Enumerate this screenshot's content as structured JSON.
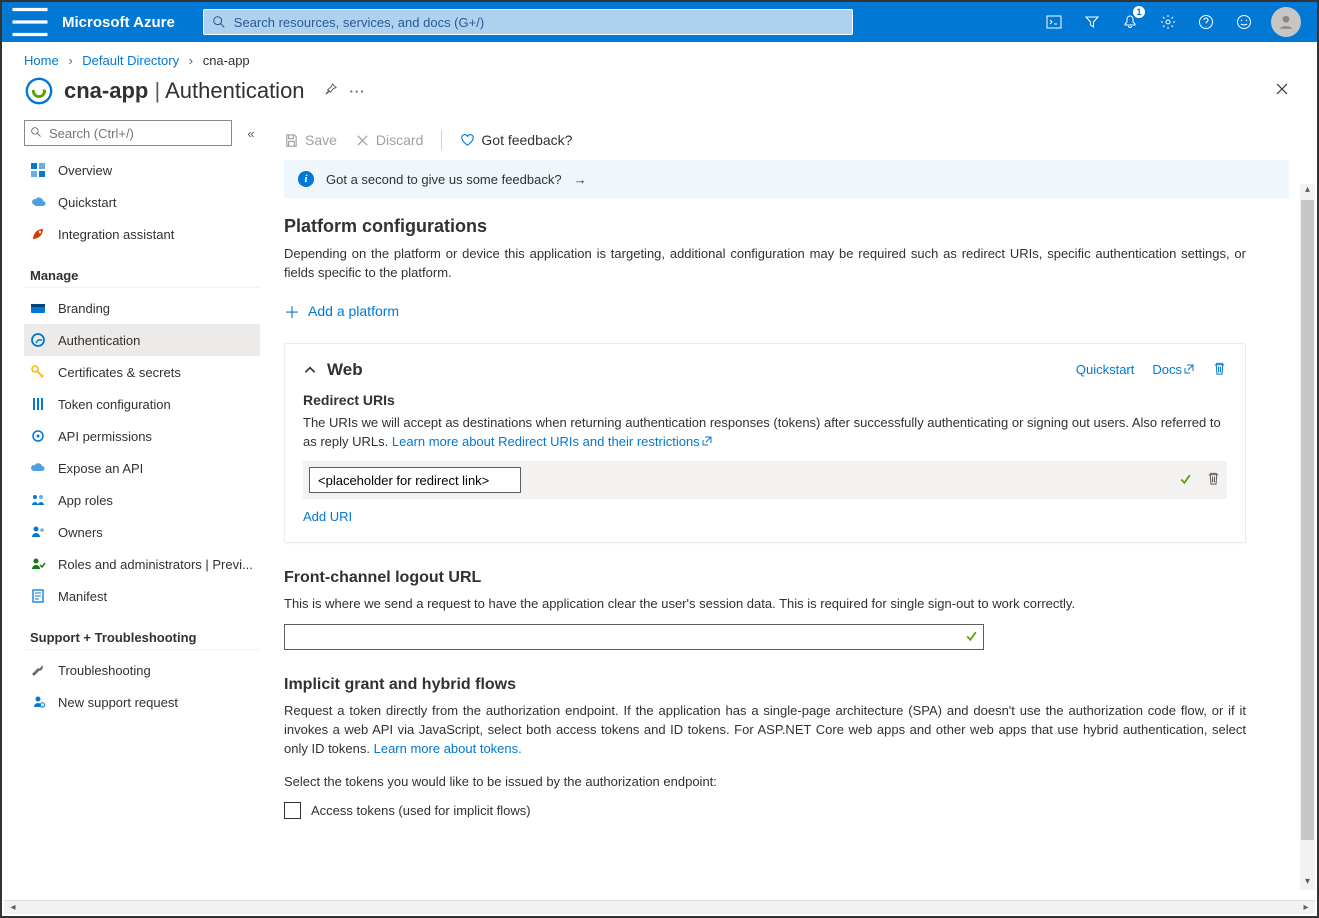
{
  "header": {
    "brand": "Microsoft Azure",
    "search_placeholder": "Search resources, services, and docs (G+/)",
    "notification_count": "1"
  },
  "breadcrumbs": {
    "items": [
      "Home",
      "Default Directory",
      "cna-app"
    ]
  },
  "title": {
    "app_name": "cna-app",
    "page_name": "Authentication"
  },
  "sidebar": {
    "search_placeholder": "Search (Ctrl+/)",
    "top_items": [
      {
        "label": "Overview",
        "icon": "overview-icon",
        "color": "#0078d4"
      },
      {
        "label": "Quickstart",
        "icon": "cloud-icon",
        "color": "#0078d4"
      },
      {
        "label": "Integration assistant",
        "icon": "rocket-icon",
        "color": "#d83b01"
      }
    ],
    "groups": [
      {
        "name": "Manage",
        "items": [
          {
            "label": "Branding",
            "icon": "branding-icon",
            "color": "#0078d4"
          },
          {
            "label": "Authentication",
            "icon": "auth-icon",
            "color": "#0078d4",
            "active": true
          },
          {
            "label": "Certificates & secrets",
            "icon": "key-icon",
            "color": "#ffb900"
          },
          {
            "label": "Token configuration",
            "icon": "token-icon",
            "color": "#0078d4"
          },
          {
            "label": "API permissions",
            "icon": "api-perm-icon",
            "color": "#0078d4"
          },
          {
            "label": "Expose an API",
            "icon": "expose-icon",
            "color": "#0078d4"
          },
          {
            "label": "App roles",
            "icon": "roles-icon",
            "color": "#0078d4"
          },
          {
            "label": "Owners",
            "icon": "owners-icon",
            "color": "#0078d4"
          },
          {
            "label": "Roles and administrators | Previ...",
            "icon": "admin-icon",
            "color": "#107c10"
          },
          {
            "label": "Manifest",
            "icon": "manifest-icon",
            "color": "#0078d4"
          }
        ]
      },
      {
        "name": "Support + Troubleshooting",
        "items": [
          {
            "label": "Troubleshooting",
            "icon": "wrench-icon",
            "color": "#605e5c"
          },
          {
            "label": "New support request",
            "icon": "support-icon",
            "color": "#0078d4"
          }
        ]
      }
    ]
  },
  "toolbar": {
    "save": "Save",
    "discard": "Discard",
    "feedback": "Got feedback?"
  },
  "banner": {
    "text": "Got a second to give us some feedback?"
  },
  "platform_config": {
    "heading": "Platform configurations",
    "desc": "Depending on the platform or device this application is targeting, additional configuration may be required such as redirect URIs, specific authentication settings, or fields specific to the platform.",
    "add_platform": "Add a platform"
  },
  "web_card": {
    "title": "Web",
    "quickstart": "Quickstart",
    "docs": "Docs",
    "redirect_heading": "Redirect URIs",
    "redirect_desc": "The URIs we will accept as destinations when returning authentication responses (tokens) after successfully authenticating or signing out users. Also referred to as reply URLs. ",
    "redirect_learn": "Learn more about Redirect URIs and their restrictions",
    "uri_value": "<placeholder for redirect link>",
    "add_uri": "Add URI"
  },
  "logout": {
    "heading": "Front-channel logout URL",
    "desc": "This is where we send a request to have the application clear the user's session data. This is required for single sign-out to work correctly.",
    "value": ""
  },
  "implicit": {
    "heading": "Implicit grant and hybrid flows",
    "desc": "Request a token directly from the authorization endpoint. If the application has a single-page architecture (SPA) and doesn't use the authorization code flow, or if it invokes a web API via JavaScript, select both access tokens and ID tokens. For ASP.NET Core web apps and other web apps that use hybrid authentication, select only ID tokens. ",
    "learn": "Learn more about tokens.",
    "select_text": "Select the tokens you would like to be issued by the authorization endpoint:",
    "checkbox1": "Access tokens (used for implicit flows)"
  }
}
